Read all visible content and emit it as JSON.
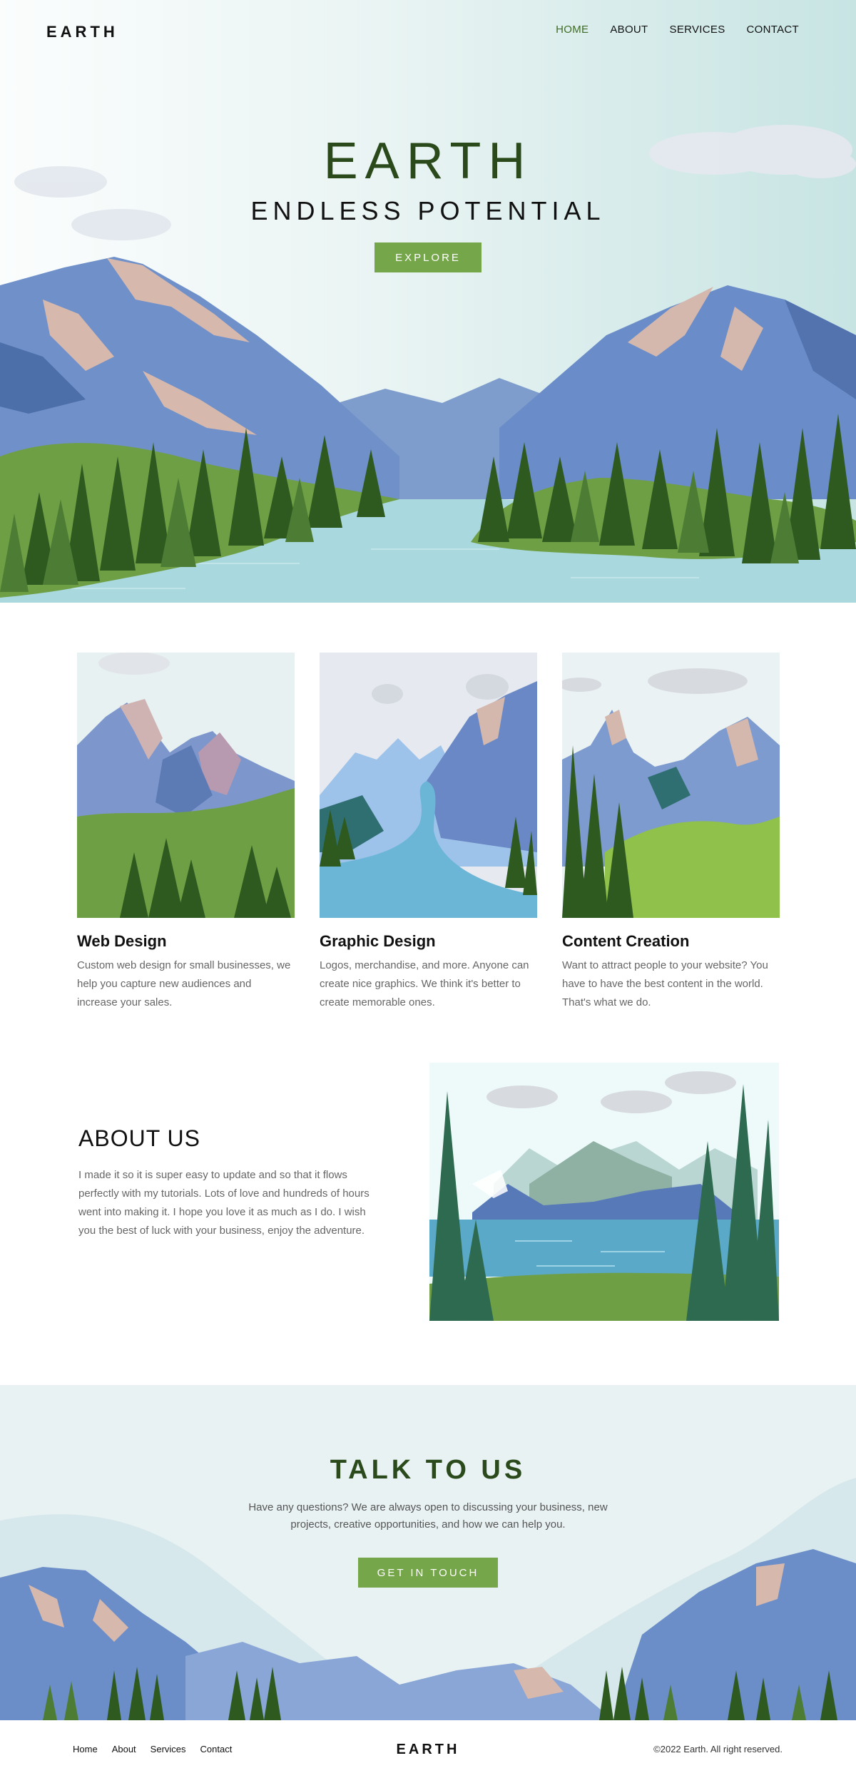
{
  "brand": "EARTH",
  "nav": {
    "home": "HOME",
    "about": "ABOUT",
    "services": "SERVICES",
    "contact": "CONTACT"
  },
  "hero": {
    "title": "EARTH",
    "subtitle": "ENDLESS POTENTIAL",
    "cta": "EXPLORE"
  },
  "services": [
    {
      "title": "Web Design",
      "text": "Custom web design for small businesses, we help you capture new audiences and increase your sales."
    },
    {
      "title": "Graphic Design",
      "text": "Logos, merchandise, and more. Anyone can create nice graphics. We think it's better to create memorable ones."
    },
    {
      "title": "Content Creation",
      "text": "Want to attract people to your website? You have to have the best content in the world. That's what we do."
    }
  ],
  "about": {
    "title": "ABOUT US",
    "text": "I made it so it is super easy to update and so that it flows perfectly with my tutorials. Lots of love and hundreds of hours went into making it. I hope you love it as much as I do. I wish you the best of luck with your business, enjoy the adventure."
  },
  "contact": {
    "title": "TALK TO US",
    "text": "Have any questions? We are always open to discussing your business, new projects, creative opportunities, and how we can help you.",
    "cta": "GET IN TOUCH"
  },
  "footer": {
    "links": [
      "Home",
      "About",
      "Services",
      "Contact"
    ],
    "brand": "EARTH",
    "copyright": "©2022 Earth. All right reserved."
  },
  "colors": {
    "accent": "#75a64a",
    "heading_green": "#2b4a1b",
    "nav_active": "#3e6b25"
  }
}
